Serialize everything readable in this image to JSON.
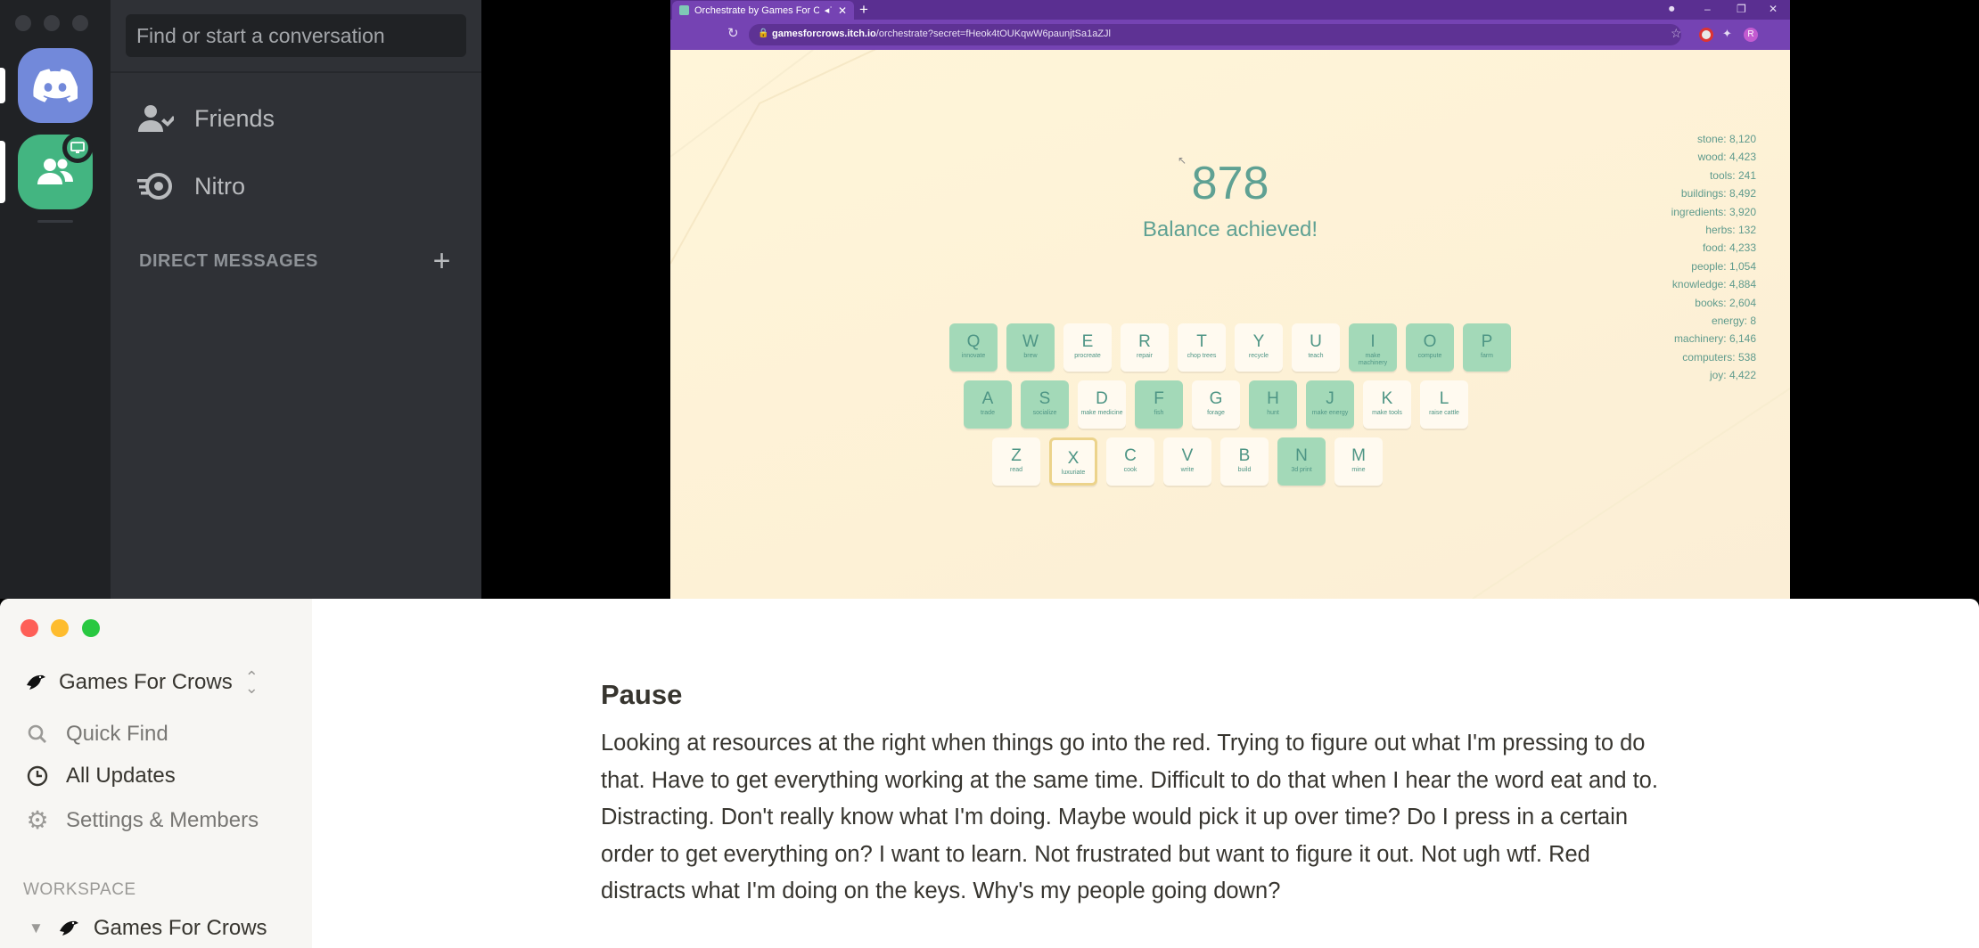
{
  "discord": {
    "search_placeholder": "Find or start a conversation",
    "nav": [
      {
        "label": "Friends",
        "icon": "friends-icon"
      },
      {
        "label": "Nitro",
        "icon": "nitro-icon"
      }
    ],
    "direct_messages_header": "DIRECT MESSAGES",
    "add_dm_label": "+",
    "colors": {
      "blurple": "#7289da",
      "green": "#43b581",
      "rail": "#202225",
      "panel": "#2f3136"
    }
  },
  "browser": {
    "tab_title": "Orchestrate by Games For Crows",
    "new_tab": "+",
    "url_host": "gamesforcrows.itch.io",
    "url_path": "/orchestrate?secret=fHeok4tOUKqwW6paunjtSa1aZJl",
    "window_controls": [
      "–",
      "❐",
      "✕"
    ]
  },
  "game": {
    "score": "878",
    "status": "Balance achieved!",
    "resources": [
      "stone: 8,120",
      "wood: 4,423",
      "tools: 241",
      "buildings: 8,492",
      "ingredients: 3,920",
      "herbs: 132",
      "food: 4,233",
      "people: 1,054",
      "knowledge: 4,884",
      "books: 2,604",
      "energy: 8",
      "machinery: 6,146",
      "computers: 538",
      "joy: 4,422"
    ],
    "rows": [
      [
        {
          "key": "Q",
          "label": "innovate",
          "on": true
        },
        {
          "key": "W",
          "label": "brew",
          "on": true
        },
        {
          "key": "E",
          "label": "procreate",
          "on": false
        },
        {
          "key": "R",
          "label": "repair",
          "on": false
        },
        {
          "key": "T",
          "label": "chop trees",
          "on": false
        },
        {
          "key": "Y",
          "label": "recycle",
          "on": false
        },
        {
          "key": "U",
          "label": "teach",
          "on": false
        },
        {
          "key": "I",
          "label": "make machinery",
          "on": true
        },
        {
          "key": "O",
          "label": "compute",
          "on": true
        },
        {
          "key": "P",
          "label": "farm",
          "on": true
        }
      ],
      [
        {
          "key": "A",
          "label": "trade",
          "on": true
        },
        {
          "key": "S",
          "label": "socialize",
          "on": true
        },
        {
          "key": "D",
          "label": "make medicine",
          "on": false
        },
        {
          "key": "F",
          "label": "fish",
          "on": true
        },
        {
          "key": "G",
          "label": "forage",
          "on": false
        },
        {
          "key": "H",
          "label": "hunt",
          "on": true
        },
        {
          "key": "J",
          "label": "make energy",
          "on": true
        },
        {
          "key": "K",
          "label": "make tools",
          "on": false
        },
        {
          "key": "L",
          "label": "raise cattle",
          "on": false
        }
      ],
      [
        {
          "key": "Z",
          "label": "read",
          "on": false
        },
        {
          "key": "X",
          "label": "luxuriate",
          "on": false,
          "selected": true
        },
        {
          "key": "C",
          "label": "cook",
          "on": false
        },
        {
          "key": "V",
          "label": "write",
          "on": false
        },
        {
          "key": "B",
          "label": "build",
          "on": false
        },
        {
          "key": "N",
          "label": "3d print",
          "on": true
        },
        {
          "key": "M",
          "label": "mine",
          "on": false
        }
      ]
    ]
  },
  "notion": {
    "workspace": "Games For Crows",
    "nav": [
      {
        "label": "Quick Find",
        "icon": "search-icon"
      },
      {
        "label": "All Updates",
        "icon": "clock-icon"
      },
      {
        "label": "Settings & Members",
        "icon": "gear-icon"
      }
    ],
    "workspace_section": "WORKSPACE",
    "workspace_page": "Games For Crows",
    "heading": "Pause",
    "body": "Looking at resources at the right when things go into the red. Trying to figure out what I'm pressing to do that. Have to get everything working at the same time. Difficult to do that when I hear the word eat and to. Distracting. Don't really know what I'm doing. Maybe would pick it up over time? Do I press in a certain order to get everything on? I want to learn. Not frustrated but want to figure it out. Not ugh wtf. Red distracts what I'm doing on the keys. Why's my people going down?"
  }
}
